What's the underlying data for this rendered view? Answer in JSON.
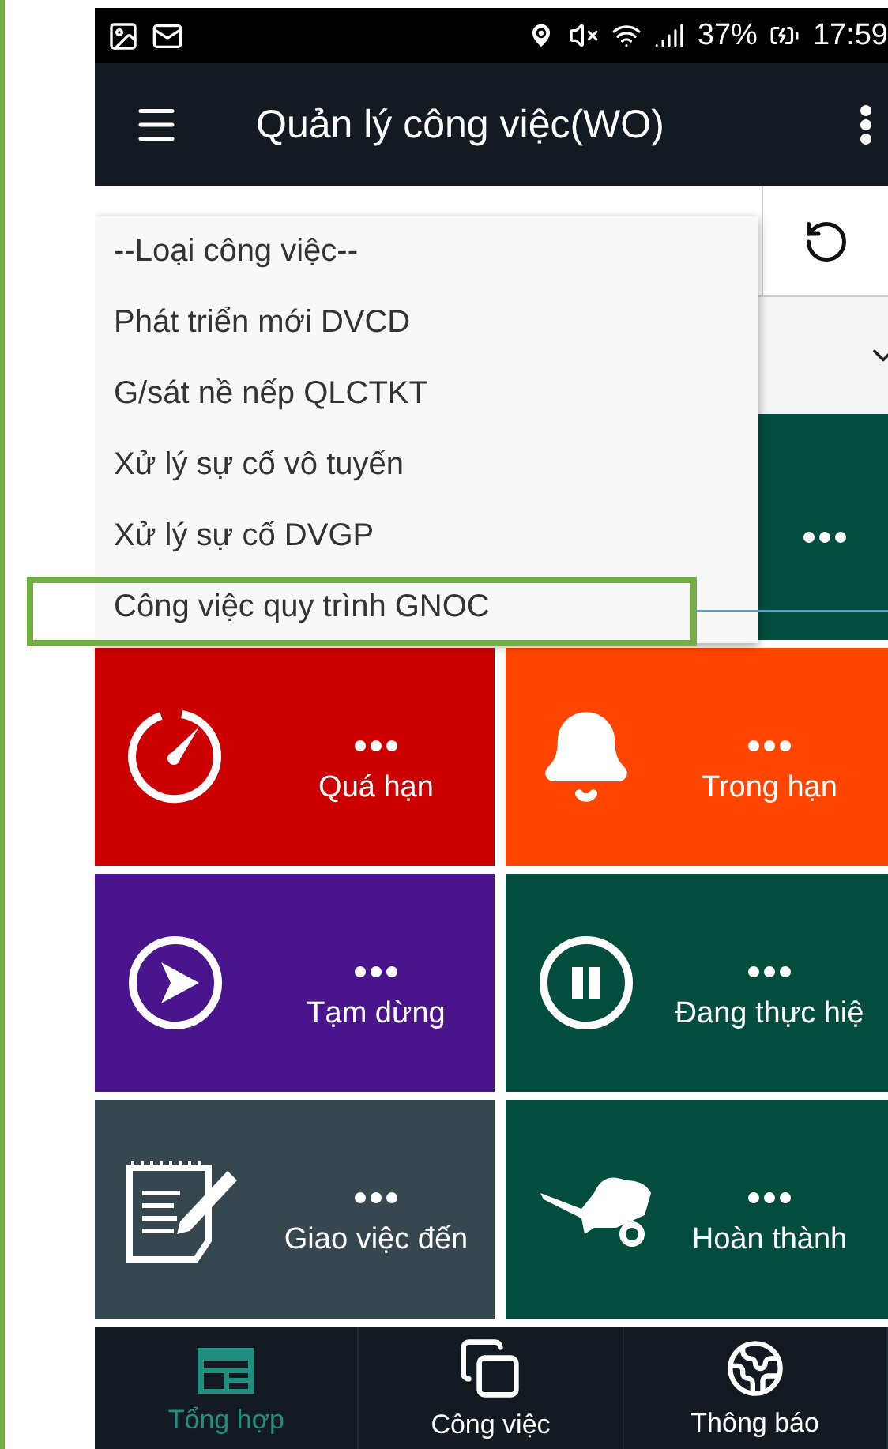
{
  "status_bar": {
    "battery": "37%",
    "time": "17:59"
  },
  "app_bar": {
    "title": "Quản lý công việc(WO)"
  },
  "dropdown": {
    "options": [
      "--Loại công việc--",
      "Phát triển mới DVCD",
      "G/sát nề nếp QLCTKT",
      "Xử lý sự cố vô tuyến",
      "Xử lý sự cố DVGP",
      "Công việc quy trình GNOC"
    ]
  },
  "tiles": [
    {
      "kind": "partial",
      "color": "#034d3f"
    },
    {
      "kind": "full",
      "label": "Quá hạn",
      "color": "#cc0000"
    },
    {
      "kind": "full",
      "label": "Trong hạn",
      "color": "#ff4500"
    },
    {
      "kind": "full",
      "label": "Tạm dừng",
      "color": "#4a148c"
    },
    {
      "kind": "full",
      "label": "Đang thực hiệ",
      "color": "#034d3f"
    },
    {
      "kind": "full",
      "label": "Giao việc đến",
      "color": "#37474f"
    },
    {
      "kind": "full",
      "label": "Hoàn thành",
      "color": "#034d3f"
    }
  ],
  "bottom_nav": [
    {
      "label": "Tổng hợp",
      "selected": true
    },
    {
      "label": "Công việc",
      "selected": false
    },
    {
      "label": "Thông báo",
      "selected": false
    }
  ]
}
